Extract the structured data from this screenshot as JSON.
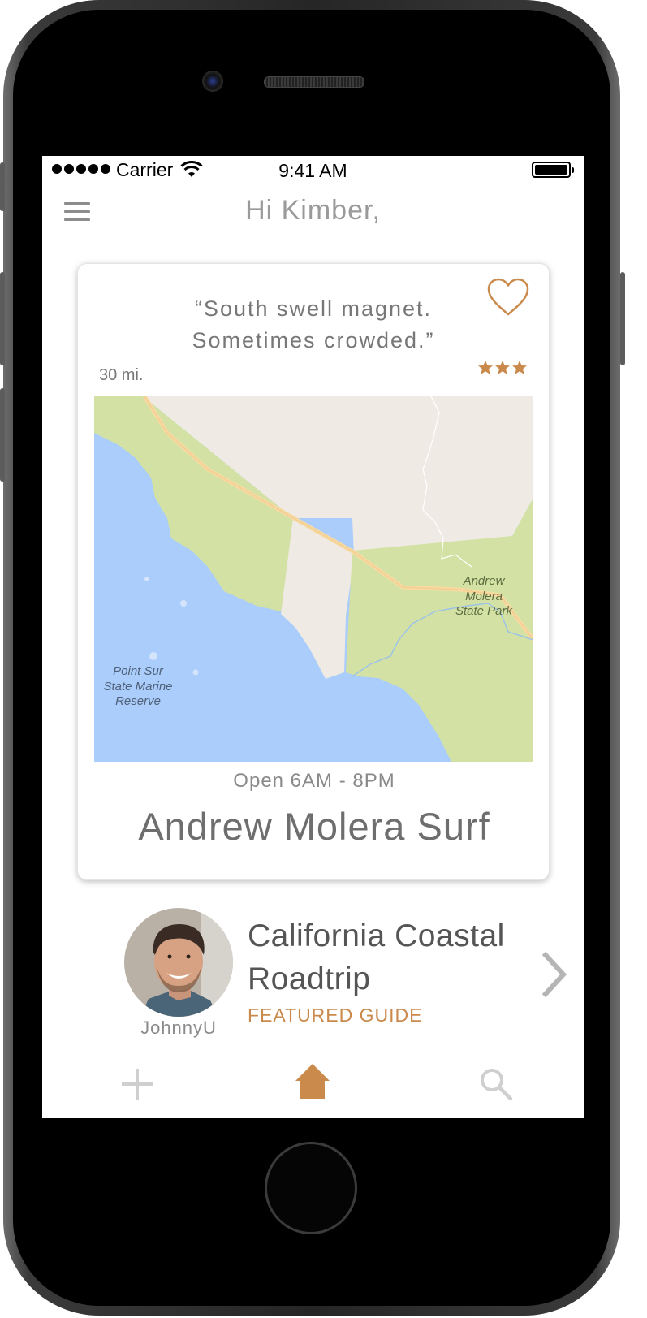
{
  "status_bar": {
    "carrier": "Carrier",
    "time": "9:41 AM"
  },
  "header": {
    "greeting": "Hi Kimber,"
  },
  "card": {
    "quote_line1": "“South swell magnet.",
    "quote_line2": "Sometimes crowded.”",
    "distance": "30 mi.",
    "rating": 3,
    "hours": "Open 6AM - 8PM",
    "name": "Andrew Molera Surf",
    "map_labels": {
      "park": [
        "Andrew",
        "Molera",
        "State Park"
      ],
      "reserve": [
        "Point Sur",
        "State Marine",
        "Reserve"
      ]
    }
  },
  "featured": {
    "title_line1": "California Coastal",
    "title_line2": "Roadtrip",
    "tag": "FEATURED GUIDE",
    "username": "JohnnyU"
  },
  "colors": {
    "accent": "#c98a4b",
    "water": "#abcdfb",
    "park": "#d3e2a4",
    "land": "#efebe4",
    "road": "#f7d9a1"
  }
}
